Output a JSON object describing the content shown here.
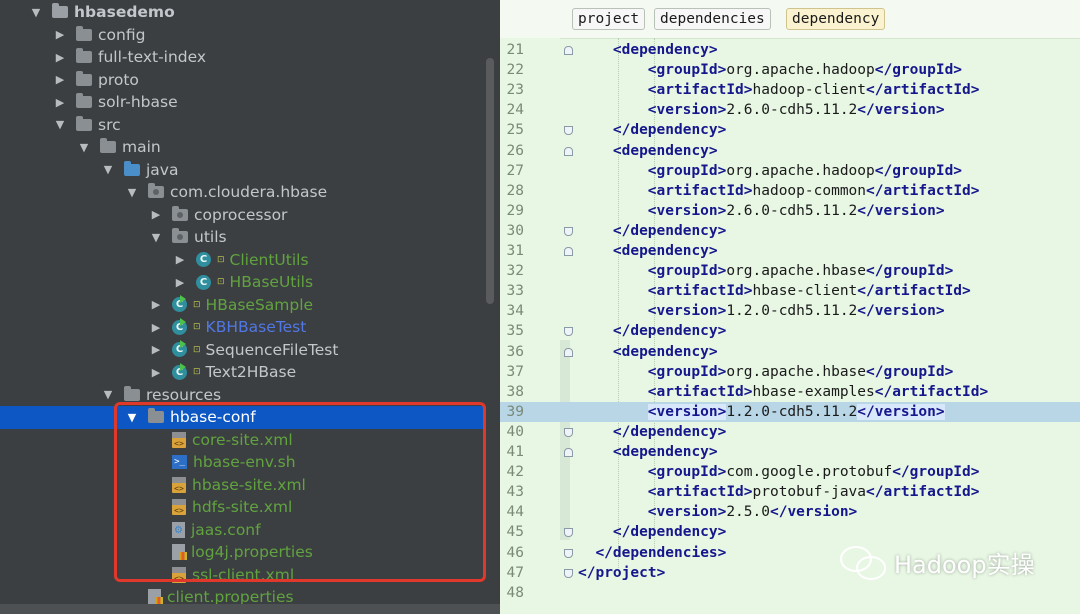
{
  "tree": {
    "items": [
      {
        "label": "hbasedemo",
        "depth": 0,
        "arrow": "down",
        "icon": "folder-root-icon",
        "style": "light"
      },
      {
        "label": "config",
        "depth": 1,
        "arrow": "right",
        "icon": "folder-icon",
        "style": "light"
      },
      {
        "label": "full-text-index",
        "depth": 1,
        "arrow": "right",
        "icon": "folder-icon",
        "style": "light"
      },
      {
        "label": "proto",
        "depth": 1,
        "arrow": "right",
        "icon": "folder-icon",
        "style": "light"
      },
      {
        "label": "solr-hbase",
        "depth": 1,
        "arrow": "right",
        "icon": "folder-icon",
        "style": "light"
      },
      {
        "label": "src",
        "depth": 1,
        "arrow": "down",
        "icon": "folder-icon",
        "style": "light"
      },
      {
        "label": "main",
        "depth": 2,
        "arrow": "down",
        "icon": "folder-icon",
        "style": "light"
      },
      {
        "label": "java",
        "depth": 3,
        "arrow": "down",
        "icon": "source-folder-icon",
        "style": "light"
      },
      {
        "label": "com.cloudera.hbase",
        "depth": 4,
        "arrow": "down",
        "icon": "package-icon",
        "style": "light"
      },
      {
        "label": "coprocessor",
        "depth": 5,
        "arrow": "right",
        "icon": "package-icon",
        "style": "light"
      },
      {
        "label": "utils",
        "depth": 5,
        "arrow": "down",
        "icon": "package-icon",
        "style": "light"
      },
      {
        "label": "ClientUtils",
        "depth": 6,
        "arrow": "right",
        "icon": "class-icon",
        "style": "green"
      },
      {
        "label": "HBaseUtils",
        "depth": 6,
        "arrow": "right",
        "icon": "class-icon",
        "style": "green"
      },
      {
        "label": "HBaseSample",
        "depth": 5,
        "arrow": "right",
        "icon": "runnable-class-icon",
        "style": "green"
      },
      {
        "label": "KBHBaseTest",
        "depth": 5,
        "arrow": "right",
        "icon": "runnable-class-icon",
        "style": "blue"
      },
      {
        "label": "SequenceFileTest",
        "depth": 5,
        "arrow": "right",
        "icon": "runnable-class-icon",
        "style": "light"
      },
      {
        "label": "Text2HBase",
        "depth": 5,
        "arrow": "right",
        "icon": "runnable-class-icon",
        "style": "light"
      },
      {
        "label": "resources",
        "depth": 3,
        "arrow": "down",
        "icon": "resources-folder-icon",
        "style": "light"
      },
      {
        "label": "hbase-conf",
        "depth": 4,
        "arrow": "down",
        "icon": "folder-icon",
        "style": "selected"
      },
      {
        "label": "core-site.xml",
        "depth": 5,
        "arrow": "none",
        "icon": "xml-file-icon",
        "style": "green"
      },
      {
        "label": "hbase-env.sh",
        "depth": 5,
        "arrow": "none",
        "icon": "shell-file-icon",
        "style": "green"
      },
      {
        "label": "hbase-site.xml",
        "depth": 5,
        "arrow": "none",
        "icon": "xml-file-icon",
        "style": "green"
      },
      {
        "label": "hdfs-site.xml",
        "depth": 5,
        "arrow": "none",
        "icon": "xml-file-icon",
        "style": "green"
      },
      {
        "label": "jaas.conf",
        "depth": 5,
        "arrow": "none",
        "icon": "config-file-icon",
        "style": "green"
      },
      {
        "label": "log4j.properties",
        "depth": 5,
        "arrow": "none",
        "icon": "properties-file-icon",
        "style": "green"
      },
      {
        "label": "ssl-client.xml",
        "depth": 5,
        "arrow": "none",
        "icon": "xml-file-icon",
        "style": "green"
      },
      {
        "label": "client.properties",
        "depth": 4,
        "arrow": "none",
        "icon": "properties-file-icon",
        "style": "green"
      }
    ]
  },
  "editor": {
    "breadcrumbs": [
      "project",
      "dependencies",
      "dependency"
    ],
    "lines": [
      {
        "num": "21",
        "indent": 4,
        "parts": [
          [
            "t",
            "<dependency>"
          ]
        ]
      },
      {
        "num": "22",
        "indent": 8,
        "parts": [
          [
            "t",
            "<groupId>"
          ],
          [
            "v",
            "org.apache.hadoop"
          ],
          [
            "t",
            "</groupId>"
          ]
        ]
      },
      {
        "num": "23",
        "indent": 8,
        "parts": [
          [
            "t",
            "<artifactId>"
          ],
          [
            "v",
            "hadoop-client"
          ],
          [
            "t",
            "</artifactId>"
          ]
        ]
      },
      {
        "num": "24",
        "indent": 8,
        "parts": [
          [
            "t",
            "<version>"
          ],
          [
            "v",
            "2.6.0-cdh5.11.2"
          ],
          [
            "t",
            "</version>"
          ]
        ]
      },
      {
        "num": "25",
        "indent": 4,
        "parts": [
          [
            "t",
            "</dependency>"
          ]
        ]
      },
      {
        "num": "26",
        "indent": 4,
        "parts": [
          [
            "t",
            "<dependency>"
          ]
        ]
      },
      {
        "num": "27",
        "indent": 8,
        "parts": [
          [
            "t",
            "<groupId>"
          ],
          [
            "v",
            "org.apache.hadoop"
          ],
          [
            "t",
            "</groupId>"
          ]
        ]
      },
      {
        "num": "28",
        "indent": 8,
        "parts": [
          [
            "t",
            "<artifactId>"
          ],
          [
            "v",
            "hadoop-common"
          ],
          [
            "t",
            "</artifactId>"
          ]
        ]
      },
      {
        "num": "29",
        "indent": 8,
        "parts": [
          [
            "t",
            "<version>"
          ],
          [
            "v",
            "2.6.0-cdh5.11.2"
          ],
          [
            "t",
            "</version>"
          ]
        ]
      },
      {
        "num": "30",
        "indent": 4,
        "parts": [
          [
            "t",
            "</dependency>"
          ]
        ]
      },
      {
        "num": "31",
        "indent": 4,
        "parts": [
          [
            "t",
            "<dependency>"
          ]
        ]
      },
      {
        "num": "32",
        "indent": 8,
        "parts": [
          [
            "t",
            "<groupId>"
          ],
          [
            "v",
            "org.apache.hbase"
          ],
          [
            "t",
            "</groupId>"
          ]
        ]
      },
      {
        "num": "33",
        "indent": 8,
        "parts": [
          [
            "t",
            "<artifactId>"
          ],
          [
            "v",
            "hbase-client"
          ],
          [
            "t",
            "</artifactId>"
          ]
        ]
      },
      {
        "num": "34",
        "indent": 8,
        "parts": [
          [
            "t",
            "<version>"
          ],
          [
            "v",
            "1.2.0-cdh5.11.2"
          ],
          [
            "t",
            "</version>"
          ]
        ]
      },
      {
        "num": "35",
        "indent": 4,
        "parts": [
          [
            "t",
            "</dependency>"
          ]
        ]
      },
      {
        "num": "36",
        "indent": 4,
        "parts": [
          [
            "t",
            "<dependency>"
          ]
        ]
      },
      {
        "num": "37",
        "indent": 8,
        "parts": [
          [
            "t",
            "<groupId>"
          ],
          [
            "v",
            "org.apache.hbase"
          ],
          [
            "t",
            "</groupId>"
          ]
        ]
      },
      {
        "num": "38",
        "indent": 8,
        "parts": [
          [
            "t",
            "<artifactId>"
          ],
          [
            "v",
            "hbase-examples"
          ],
          [
            "t",
            "</artifactId>"
          ]
        ]
      },
      {
        "num": "39",
        "indent": 8,
        "current": true,
        "parts": [
          [
            "s",
            "<version>"
          ],
          [
            "v",
            "1.2.0-cdh5.11.2"
          ],
          [
            "s",
            "</version>"
          ]
        ]
      },
      {
        "num": "40",
        "indent": 4,
        "parts": [
          [
            "t",
            "</dependency>"
          ]
        ]
      },
      {
        "num": "41",
        "indent": 4,
        "parts": [
          [
            "t",
            "<dependency>"
          ]
        ]
      },
      {
        "num": "42",
        "indent": 8,
        "parts": [
          [
            "t",
            "<groupId>"
          ],
          [
            "v",
            "com.google.protobuf"
          ],
          [
            "t",
            "</groupId>"
          ]
        ]
      },
      {
        "num": "43",
        "indent": 8,
        "parts": [
          [
            "t",
            "<artifactId>"
          ],
          [
            "v",
            "protobuf-java"
          ],
          [
            "t",
            "</artifactId>"
          ]
        ]
      },
      {
        "num": "44",
        "indent": 8,
        "parts": [
          [
            "t",
            "<version>"
          ],
          [
            "v",
            "2.5.0"
          ],
          [
            "t",
            "</version>"
          ]
        ]
      },
      {
        "num": "45",
        "indent": 4,
        "parts": [
          [
            "t",
            "</dependency>"
          ]
        ]
      },
      {
        "num": "46",
        "indent": 2,
        "parts": [
          [
            "t",
            "</dependencies>"
          ]
        ]
      },
      {
        "num": "47",
        "indent": 0,
        "parts": [
          [
            "t",
            "</project>"
          ]
        ]
      },
      {
        "num": "48",
        "indent": 0,
        "parts": []
      }
    ]
  },
  "watermark": {
    "icon": "wechat-icon",
    "text": "Hadoop实操"
  },
  "colors": {
    "selection": "#0d57c4",
    "highlight_box": "#e0382a",
    "editor_bg": "#e8f7e4",
    "current_line": "#b8d6e6",
    "tag": "#16178c",
    "tree_green": "#61a33f",
    "tree_blue": "#5177e6"
  }
}
